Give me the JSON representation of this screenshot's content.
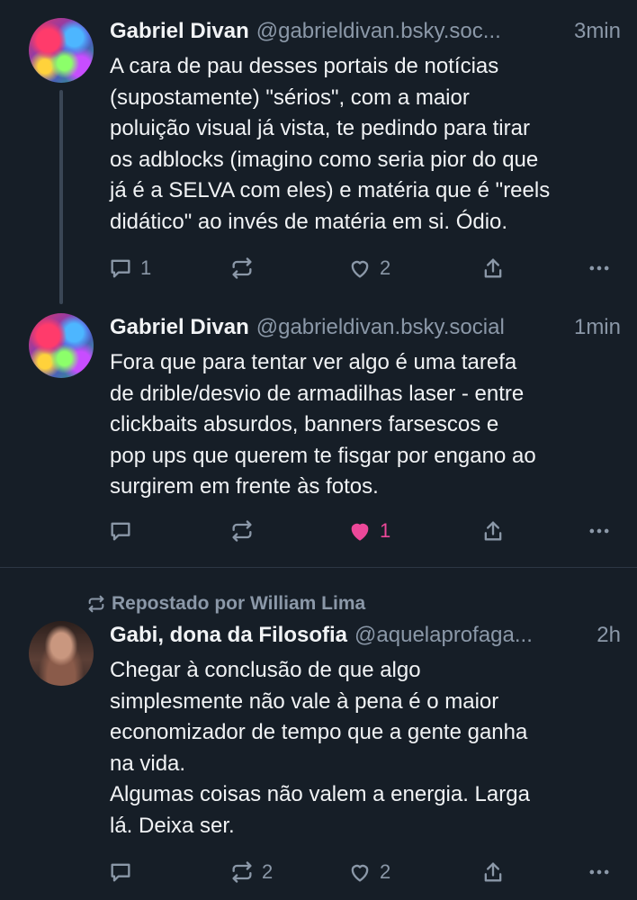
{
  "posts": [
    {
      "name": "Gabriel Divan",
      "handle": "@gabrieldivan.bsky.soc...",
      "time": "3min",
      "text": "A cara de pau desses portais de notícias\n(supostamente) \"sérios\", com a maior\npoluição visual já vista, te pedindo para tirar\nos adblocks (imagino como seria pior do que\njá é a SELVA com eles) e matéria que é \"reels\ndidático\" ao invés de matéria em si. Ódio.",
      "replies": "1",
      "reposts": "",
      "likes": "2",
      "liked": false
    },
    {
      "name": "Gabriel Divan",
      "handle": "@gabrieldivan.bsky.social",
      "time": "1min",
      "text": "Fora que para tentar ver algo é uma tarefa\nde drible/desvio de armadilhas laser - entre\nclickbaits absurdos, banners farsescos e\npop ups que querem te fisgar por engano ao\nsurgirem em frente às fotos.",
      "replies": "",
      "reposts": "",
      "likes": "1",
      "liked": true
    },
    {
      "repost_by": "Repostado por William Lima",
      "name": "Gabi, dona da Filosofia",
      "handle": "@aquelaprofaga...",
      "time": "2h",
      "text": "Chegar à conclusão de que algo\nsimplesmente não vale à pena é o maior\neconomizador de tempo que a gente ganha\nna vida.\nAlgumas coisas não valem a energia. Larga\nlá. Deixa ser.",
      "replies": "",
      "reposts": "2",
      "likes": "2",
      "liked": false
    }
  ],
  "colors": {
    "background": "#161e27",
    "muted": "#8b98a8",
    "like_active": "#ec4899"
  }
}
